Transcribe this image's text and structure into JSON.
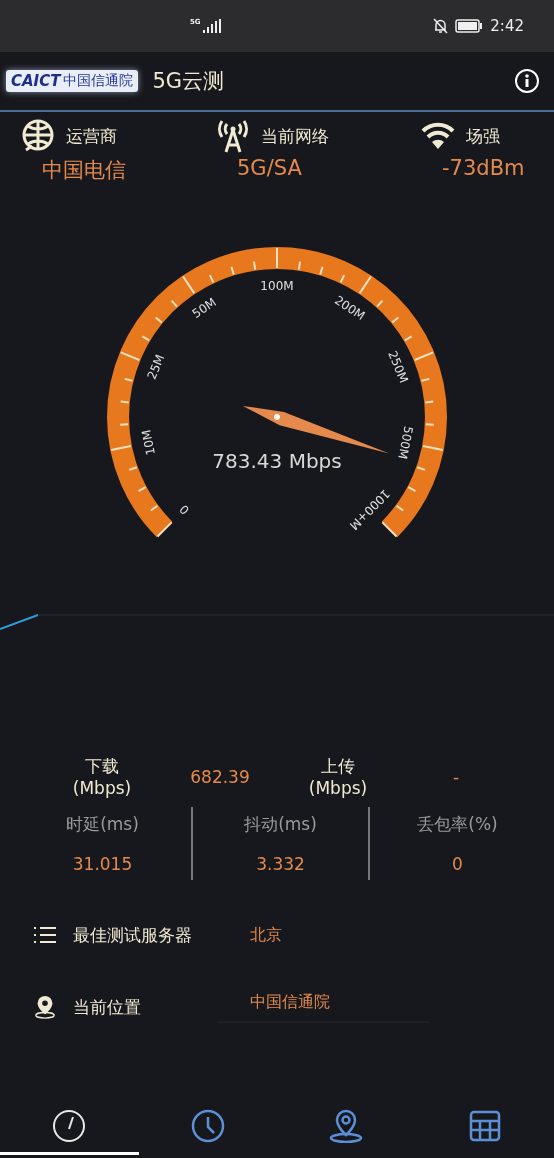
{
  "status_bar": {
    "network": "5G",
    "time": "2:42"
  },
  "header": {
    "logo_mark": "CAICT",
    "logo_name": "中国信通院",
    "title": "5G云测"
  },
  "info": [
    {
      "kind": "globe",
      "label": "运营商",
      "value": "中国电信"
    },
    {
      "kind": "antenna",
      "label": "当前网络",
      "value": "5G/SA"
    },
    {
      "kind": "wifi",
      "label": "场强",
      "value": "-73dBm"
    }
  ],
  "gauge": {
    "labels": [
      "0",
      "10M",
      "25M",
      "50M",
      "100M",
      "200M",
      "250M",
      "500M",
      "1000+M"
    ],
    "reading": "783.43 Mbps"
  },
  "speeds": [
    {
      "label": "下载",
      "unit": "(Mbps)",
      "value": "682.39"
    },
    {
      "label": "上传",
      "unit": "(Mbps)",
      "value": "-"
    }
  ],
  "metrics": [
    {
      "label": "时延(ms)",
      "value": "31.015"
    },
    {
      "label": "抖动(ms)",
      "value": "3.332"
    },
    {
      "label": "丢包率(%)",
      "value": "0"
    }
  ],
  "rows": [
    {
      "kind": "list",
      "label": "最佳测试服务器",
      "value": "北京"
    },
    {
      "kind": "pin",
      "label": "当前位置",
      "value": "中国信通院"
    }
  ],
  "nav": [
    {
      "kind": "gauge",
      "selected": true
    },
    {
      "kind": "clock",
      "selected": false
    },
    {
      "kind": "pin",
      "selected": false
    },
    {
      "kind": "table",
      "selected": false
    }
  ]
}
